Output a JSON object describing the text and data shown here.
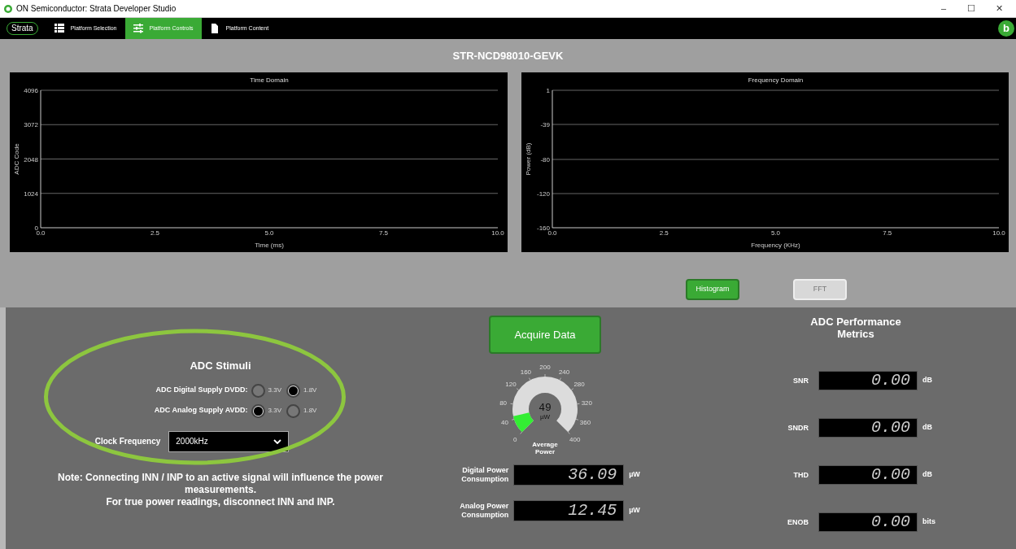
{
  "window": {
    "title": "ON Semiconductor: Strata Developer Studio",
    "controls": [
      "–",
      "☐",
      "✕"
    ]
  },
  "nav": {
    "logo": "Strata",
    "tabs": [
      {
        "label": "Platform Selection",
        "selected": false
      },
      {
        "label": "Platform Controls",
        "selected": true
      },
      {
        "label": "Platform Content",
        "selected": false
      }
    ],
    "user_initial": "b"
  },
  "board_title": "STR-NCD98010-GEVK",
  "charts": [
    {
      "chart_data": {
        "type": "line",
        "grid": true,
        "title": "Time Domain",
        "xlabel": "Time (ms)",
        "ylabel": "ADC Code",
        "xlim": [
          0,
          10
        ],
        "ylim": [
          0,
          4096
        ],
        "xticks": [
          {
            "value": 0,
            "label": "0.0"
          },
          {
            "value": 2.5,
            "label": "2.5"
          },
          {
            "value": 5,
            "label": "5.0"
          },
          {
            "value": 7.5,
            "label": "7.5"
          },
          {
            "value": 10,
            "label": "10.0"
          }
        ],
        "yticks": [
          0,
          1024,
          2048,
          3072,
          4096
        ]
      }
    },
    {
      "chart_data": {
        "type": "line",
        "grid": true,
        "title": "Frequency Domain",
        "xlabel": "Frequency (KHz)",
        "ylabel": "Power (dB)",
        "xlim": [
          0,
          10
        ],
        "ylim": [
          -160,
          1
        ],
        "xticks": [
          {
            "value": 0,
            "label": "0.0"
          },
          {
            "value": 2.5,
            "label": "2.5"
          },
          {
            "value": 5,
            "label": "5.0"
          },
          {
            "value": 7.5,
            "label": "7.5"
          },
          {
            "value": 10,
            "label": "10.0"
          }
        ],
        "yticks": [
          -160,
          -120,
          -80,
          -39,
          1
        ]
      }
    }
  ],
  "view_buttons": [
    {
      "label": "Histogram",
      "selected": true
    },
    {
      "label": "FFT",
      "selected": false
    }
  ],
  "stimuli": {
    "title": "ADC Stimuli",
    "supplies": [
      {
        "label": "ADC Digital Supply DVDD:",
        "options": [
          {
            "label": "3.3V",
            "selected": false
          },
          {
            "label": "1.8V",
            "selected": true
          }
        ]
      },
      {
        "label": "ADC Analog Supply AVDD:",
        "options": [
          {
            "label": "3.3V",
            "selected": true
          },
          {
            "label": "1.8V",
            "selected": false
          }
        ]
      }
    ],
    "clock": {
      "label": "Clock Frequency",
      "value": "2000kHz"
    },
    "note": [
      "Note: Connecting INN / INP to an active signal will influence the power measurements.",
      "For true power readings, disconnect INN and INP."
    ]
  },
  "acquire_button": "Acquire Data",
  "gauge": {
    "value": "49",
    "unit": "µW",
    "label": "Average Power",
    "ticks": [
      "0",
      "40",
      "80",
      "120",
      "160",
      "200",
      "240",
      "280",
      "320",
      "360",
      "400"
    ]
  },
  "power": [
    {
      "label": "Digital Power Consumption",
      "value": "36.09",
      "unit": "µW"
    },
    {
      "label": "Analog Power Consumption",
      "value": "12.45",
      "unit": "µW"
    }
  ],
  "metrics": {
    "title": "ADC Performance Metrics",
    "items": [
      {
        "label": "SNR",
        "value": "0.00",
        "unit": "dB"
      },
      {
        "label": "SNDR",
        "value": "0.00",
        "unit": "dB"
      },
      {
        "label": "THD",
        "value": "0.00",
        "unit": "dB"
      },
      {
        "label": "ENOB",
        "value": "0.00",
        "unit": "bits"
      }
    ]
  }
}
